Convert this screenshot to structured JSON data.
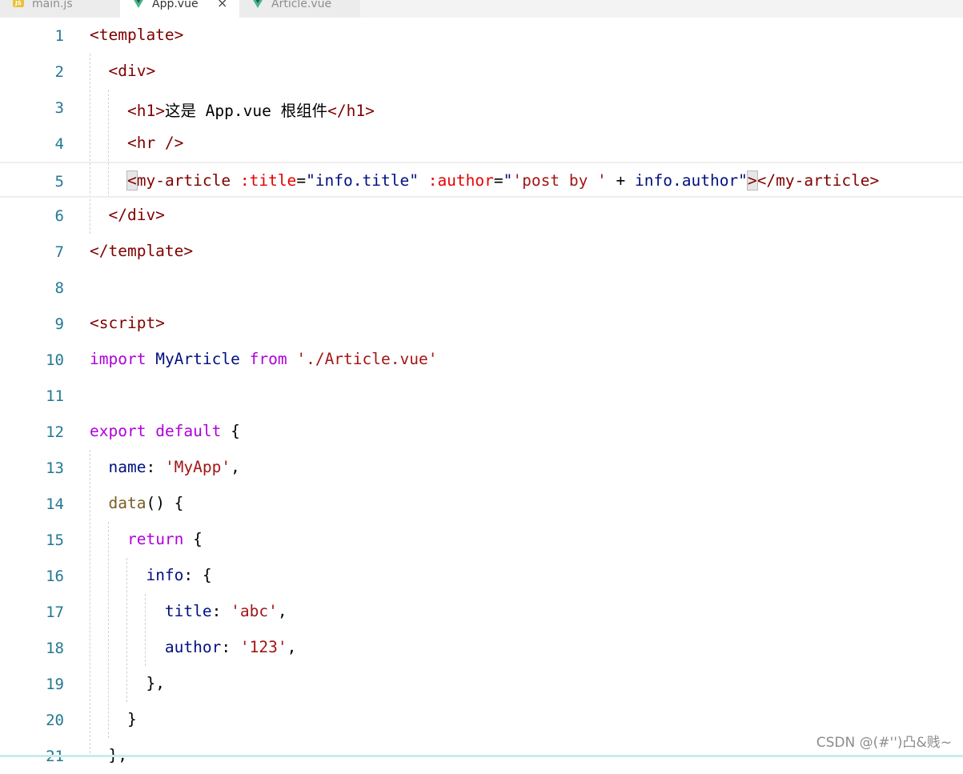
{
  "tabs": [
    {
      "label": "main.js",
      "icon": "js-icon"
    },
    {
      "label": "App.vue",
      "icon": "vue-icon",
      "active": true,
      "close": "×"
    },
    {
      "label": "Article.vue",
      "icon": "vue-icon"
    }
  ],
  "lines": [
    {
      "n": "1",
      "tokens": [
        {
          "c": "tag",
          "t": "<template>"
        }
      ]
    },
    {
      "n": "2",
      "tokens": [
        {
          "c": "pun",
          "t": "  "
        },
        {
          "c": "tag",
          "t": "<div>"
        }
      ]
    },
    {
      "n": "3",
      "tokens": [
        {
          "c": "pun",
          "t": "    "
        },
        {
          "c": "tag",
          "t": "<h1>"
        },
        {
          "c": "pun",
          "t": "这是 App.vue 根组件"
        },
        {
          "c": "tag",
          "t": "</h1>"
        }
      ]
    },
    {
      "n": "4",
      "tokens": [
        {
          "c": "pun",
          "t": "    "
        },
        {
          "c": "tag",
          "t": "<hr />"
        }
      ]
    },
    {
      "n": "5",
      "current": true,
      "tokens": [
        {
          "c": "pun",
          "t": "    "
        },
        {
          "c": "tag bracket-box",
          "t": "<"
        },
        {
          "c": "tag",
          "t": "my-article "
        },
        {
          "c": "attr",
          "t": ":title"
        },
        {
          "c": "pun",
          "t": "="
        },
        {
          "c": "id",
          "t": "\"info.title\""
        },
        {
          "c": "pun",
          "t": " "
        },
        {
          "c": "attr",
          "t": ":author"
        },
        {
          "c": "pun",
          "t": "="
        },
        {
          "c": "id",
          "t": "\""
        },
        {
          "c": "str",
          "t": "'post by '"
        },
        {
          "c": "pun",
          "t": " + "
        },
        {
          "c": "id",
          "t": "info.author\""
        },
        {
          "c": "tag bracket-box",
          "t": ">"
        },
        {
          "c": "tag",
          "t": "</my-article>"
        }
      ]
    },
    {
      "n": "6",
      "tokens": [
        {
          "c": "pun",
          "t": "  "
        },
        {
          "c": "tag",
          "t": "</div>"
        }
      ]
    },
    {
      "n": "7",
      "tokens": [
        {
          "c": "tag",
          "t": "</template>"
        }
      ]
    },
    {
      "n": "8",
      "tokens": []
    },
    {
      "n": "9",
      "tokens": [
        {
          "c": "tag",
          "t": "<script>"
        }
      ]
    },
    {
      "n": "10",
      "tokens": [
        {
          "c": "kw",
          "t": "import"
        },
        {
          "c": "pun",
          "t": " "
        },
        {
          "c": "id",
          "t": "MyArticle"
        },
        {
          "c": "pun",
          "t": " "
        },
        {
          "c": "kw",
          "t": "from"
        },
        {
          "c": "pun",
          "t": " "
        },
        {
          "c": "str",
          "t": "'./Article.vue'"
        }
      ]
    },
    {
      "n": "11",
      "tokens": []
    },
    {
      "n": "12",
      "tokens": [
        {
          "c": "kw",
          "t": "export"
        },
        {
          "c": "pun",
          "t": " "
        },
        {
          "c": "kw",
          "t": "default"
        },
        {
          "c": "pun",
          "t": " {"
        }
      ]
    },
    {
      "n": "13",
      "tokens": [
        {
          "c": "pun",
          "t": "  "
        },
        {
          "c": "id",
          "t": "name"
        },
        {
          "c": "pun",
          "t": ": "
        },
        {
          "c": "str",
          "t": "'MyApp'"
        },
        {
          "c": "pun",
          "t": ","
        }
      ]
    },
    {
      "n": "14",
      "tokens": [
        {
          "c": "pun",
          "t": "  "
        },
        {
          "c": "fn",
          "t": "data"
        },
        {
          "c": "pun",
          "t": "() {"
        }
      ]
    },
    {
      "n": "15",
      "tokens": [
        {
          "c": "pun",
          "t": "    "
        },
        {
          "c": "kw",
          "t": "return"
        },
        {
          "c": "pun",
          "t": " {"
        }
      ]
    },
    {
      "n": "16",
      "tokens": [
        {
          "c": "pun",
          "t": "      "
        },
        {
          "c": "id",
          "t": "info"
        },
        {
          "c": "pun",
          "t": ": {"
        }
      ]
    },
    {
      "n": "17",
      "tokens": [
        {
          "c": "pun",
          "t": "        "
        },
        {
          "c": "id",
          "t": "title"
        },
        {
          "c": "pun",
          "t": ": "
        },
        {
          "c": "str",
          "t": "'abc'"
        },
        {
          "c": "pun",
          "t": ","
        }
      ]
    },
    {
      "n": "18",
      "tokens": [
        {
          "c": "pun",
          "t": "        "
        },
        {
          "c": "id",
          "t": "author"
        },
        {
          "c": "pun",
          "t": ": "
        },
        {
          "c": "str",
          "t": "'123'"
        },
        {
          "c": "pun",
          "t": ","
        }
      ]
    },
    {
      "n": "19",
      "tokens": [
        {
          "c": "pun",
          "t": "      "
        },
        {
          "c": "pun",
          "t": "},"
        }
      ]
    },
    {
      "n": "20",
      "tokens": [
        {
          "c": "pun",
          "t": "    "
        },
        {
          "c": "pun",
          "t": "}"
        }
      ]
    },
    {
      "n": "21",
      "tokens": [
        {
          "c": "pun",
          "t": "  "
        },
        {
          "c": "pun",
          "t": "},"
        }
      ]
    }
  ],
  "watermark": "CSDN @(#'')凸&贱~",
  "colors": {
    "tag": "#800000",
    "attribute": "#e50000",
    "string": "#a31515",
    "keyword": "#af00db",
    "identifier": "#001080",
    "function": "#795e26",
    "line_number": "#237893"
  }
}
